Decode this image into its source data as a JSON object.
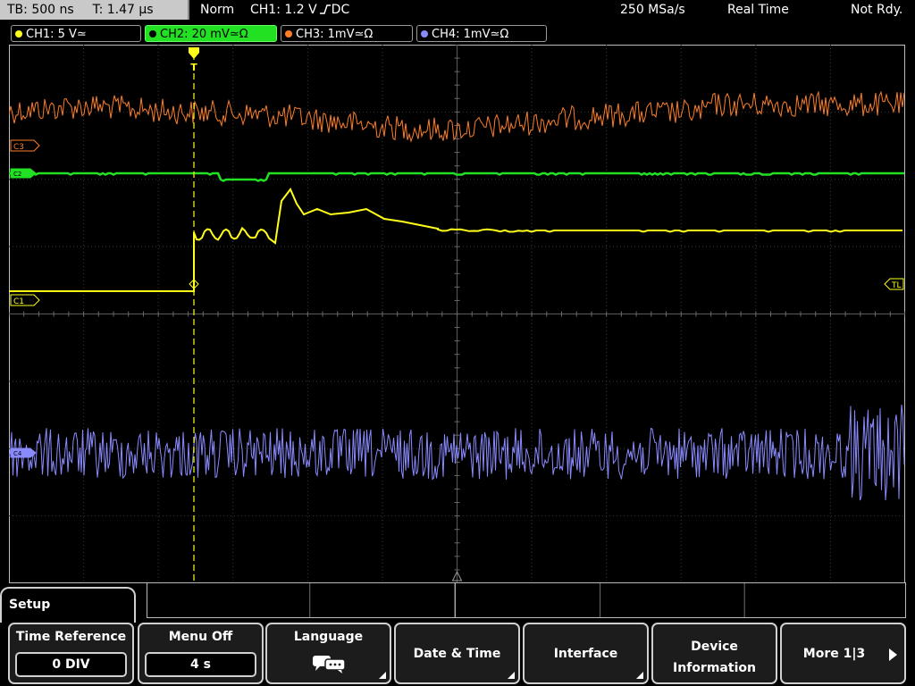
{
  "status": {
    "timebase": "TB: 500 ns",
    "trigger_time": "T: 1.47 μs",
    "mode": "Norm",
    "trigger_source": "CH1: 1.2 V",
    "coupling": "DC",
    "sample_rate": "250 MSa/s",
    "acquisition": "Real Time",
    "ready_state": "Not Rdy."
  },
  "channels": [
    {
      "label": "CH1: 5 V≃",
      "color": "#ffff1a",
      "active": false
    },
    {
      "label": "CH2: 20 mV≃Ω",
      "color": "#22e022",
      "active": true
    },
    {
      "label": "CH3: 1mV≃Ω",
      "color": "#ff7f27",
      "active": false
    },
    {
      "label": "CH4: 1mV≃Ω",
      "color": "#8a8aff",
      "active": false
    }
  ],
  "markers": {
    "c3": "C3",
    "c2": "C2",
    "c1": "C1",
    "c4": "C4",
    "trigger_level": "TL",
    "trigger_point": "T"
  },
  "menu": {
    "title": "Setup",
    "buttons": [
      {
        "id": "time-reference",
        "label": "Time Reference",
        "value": "0 DIV"
      },
      {
        "id": "menu-off",
        "label": "Menu Off",
        "value": "4 s"
      },
      {
        "id": "language",
        "label": "Language",
        "icon": "speech-bubbles-icon"
      },
      {
        "id": "date-time",
        "label": "Date & Time"
      },
      {
        "id": "interface",
        "label": "Interface"
      },
      {
        "id": "device-information",
        "label": "Device\nInformation"
      },
      {
        "id": "more",
        "label": "More 1|3"
      }
    ]
  }
}
